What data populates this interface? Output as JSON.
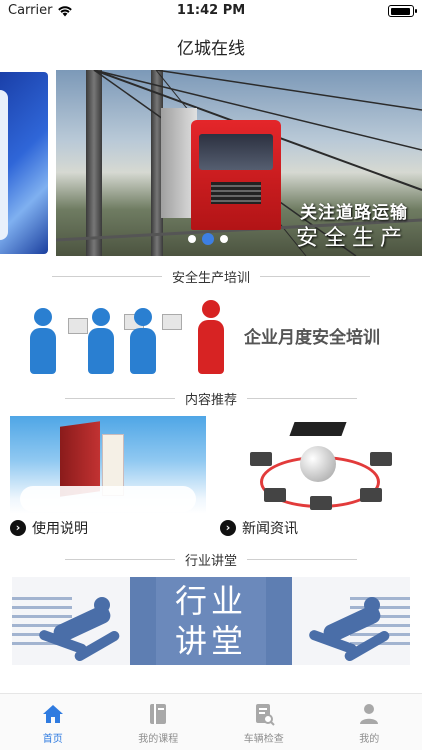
{
  "status_bar": {
    "carrier": "Carrier",
    "time": "11:42 PM"
  },
  "nav": {
    "title": "亿城在线"
  },
  "banner": {
    "caption_line1": "关注道路运输",
    "caption_line2": "安全生产",
    "page_count": 3,
    "active_page": 2
  },
  "sections": {
    "training_title": "安全生产培训",
    "content_title": "内容推荐",
    "lecture_title": "行业讲堂"
  },
  "training": {
    "label": "企业月度安全培训"
  },
  "cards": [
    {
      "label": "使用说明"
    },
    {
      "label": "新闻资讯"
    }
  ],
  "lecture": {
    "line1": "行业",
    "line2": "讲堂"
  },
  "tabs": [
    {
      "label": "首页",
      "icon": "home-icon",
      "active": true
    },
    {
      "label": "我的课程",
      "icon": "book-icon",
      "active": false
    },
    {
      "label": "车辆检查",
      "icon": "inspection-icon",
      "active": false
    },
    {
      "label": "我的",
      "icon": "profile-icon",
      "active": false
    }
  ],
  "colors": {
    "accent": "#2f7be0",
    "tab_inactive": "#8e8e8e"
  }
}
